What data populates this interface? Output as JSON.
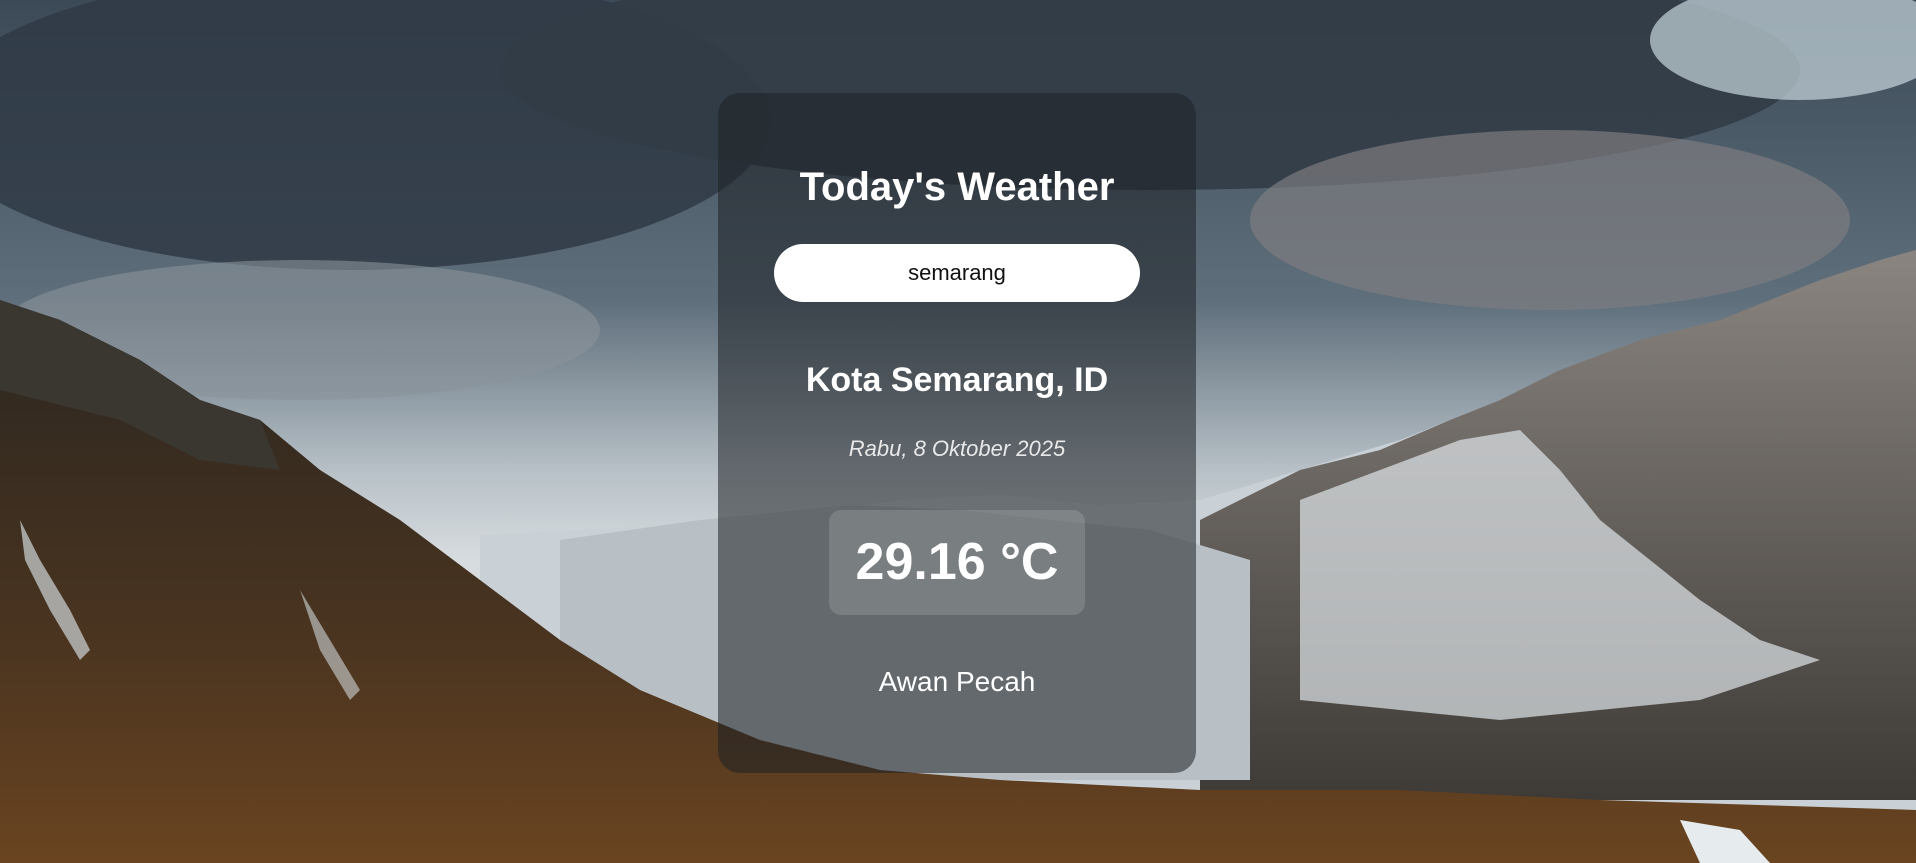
{
  "weather": {
    "title": "Today's Weather",
    "search_value": "semarang",
    "location": "Kota Semarang, ID",
    "date": "Rabu, 8 Oktober 2025",
    "temperature": "29.16 °C",
    "description": "Awan Pecah"
  },
  "colors": {
    "card_background": "#1e2024",
    "text": "#ffffff",
    "input_background": "#ffffff"
  }
}
